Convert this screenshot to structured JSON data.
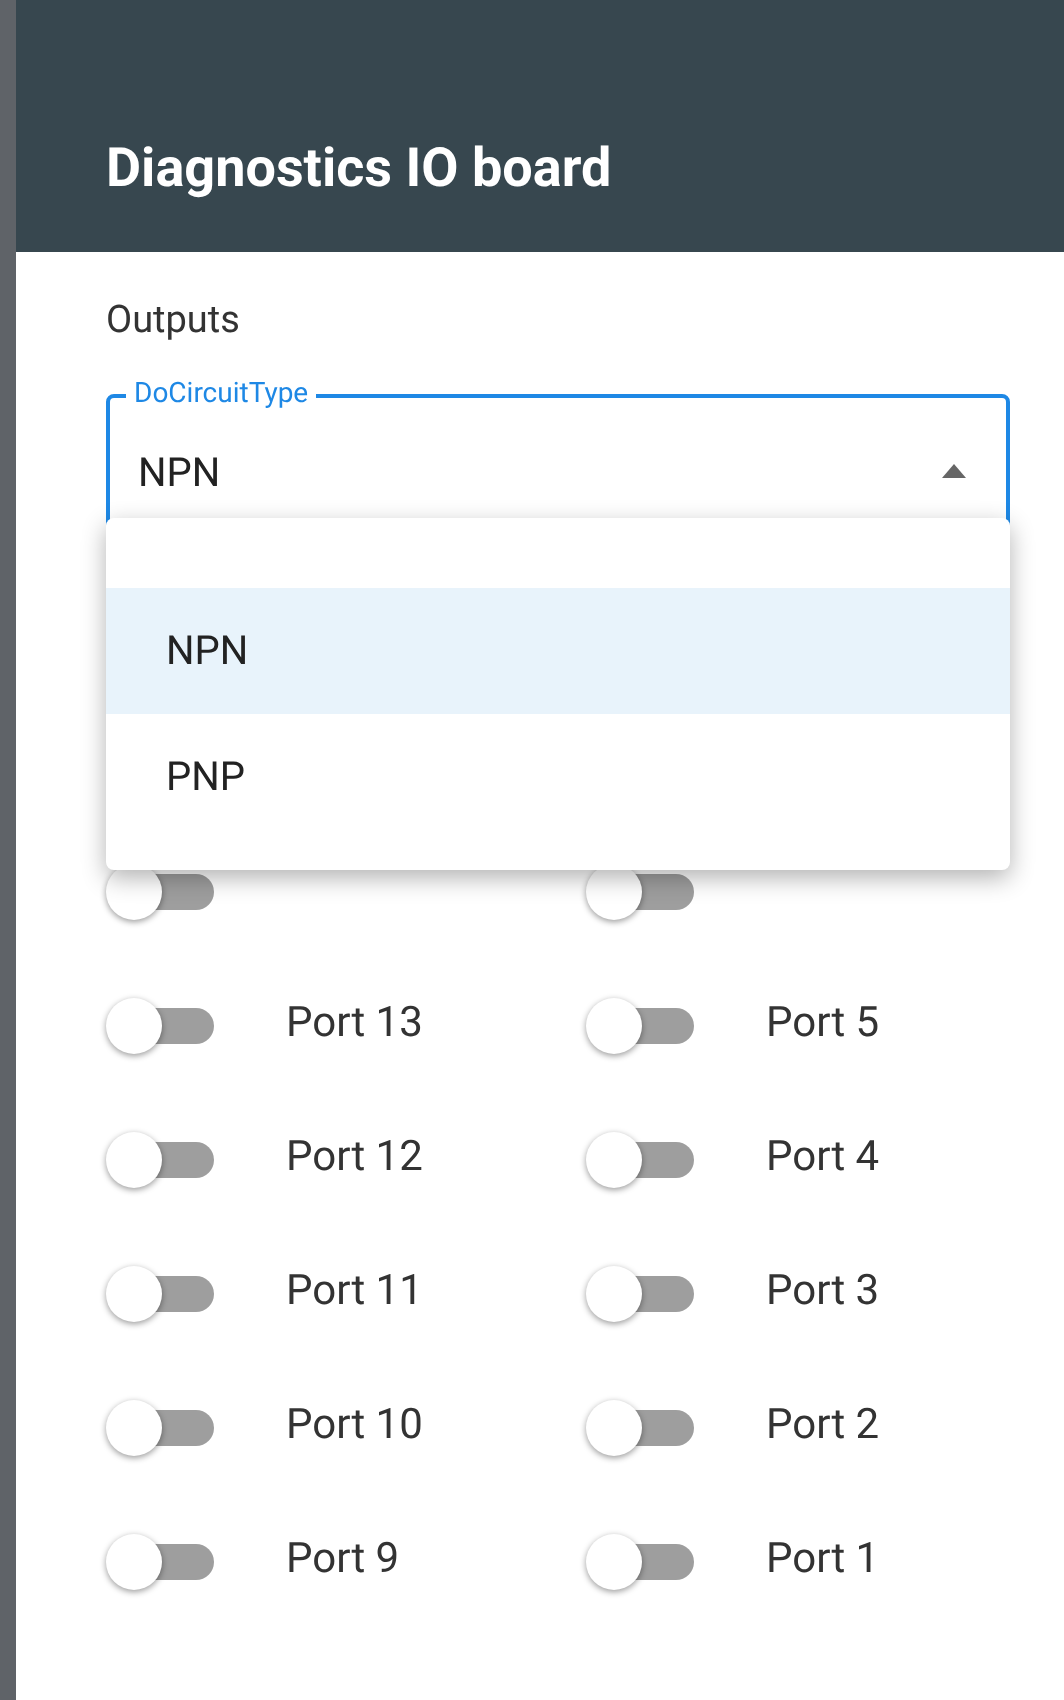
{
  "header": {
    "title": "Diagnostics IO board"
  },
  "section_title": "Outputs",
  "select": {
    "label": "DoCircuitType",
    "value": "NPN",
    "expanded": true,
    "options": [
      {
        "label": "NPN",
        "selected": true
      },
      {
        "label": "PNP",
        "selected": false
      }
    ]
  },
  "ports_left": [
    {
      "on": false
    },
    {
      "label": "Port 13",
      "on": false
    },
    {
      "label": "Port 12",
      "on": false
    },
    {
      "label": "Port 11",
      "on": false
    },
    {
      "label": "Port 10",
      "on": false
    },
    {
      "label": "Port 9",
      "on": false
    }
  ],
  "ports_right": [
    {
      "on": false
    },
    {
      "label": "Port 5",
      "on": false
    },
    {
      "label": "Port 4",
      "on": false
    },
    {
      "label": "Port 3",
      "on": false
    },
    {
      "label": "Port 2",
      "on": false
    },
    {
      "label": "Port 1",
      "on": false
    }
  ]
}
